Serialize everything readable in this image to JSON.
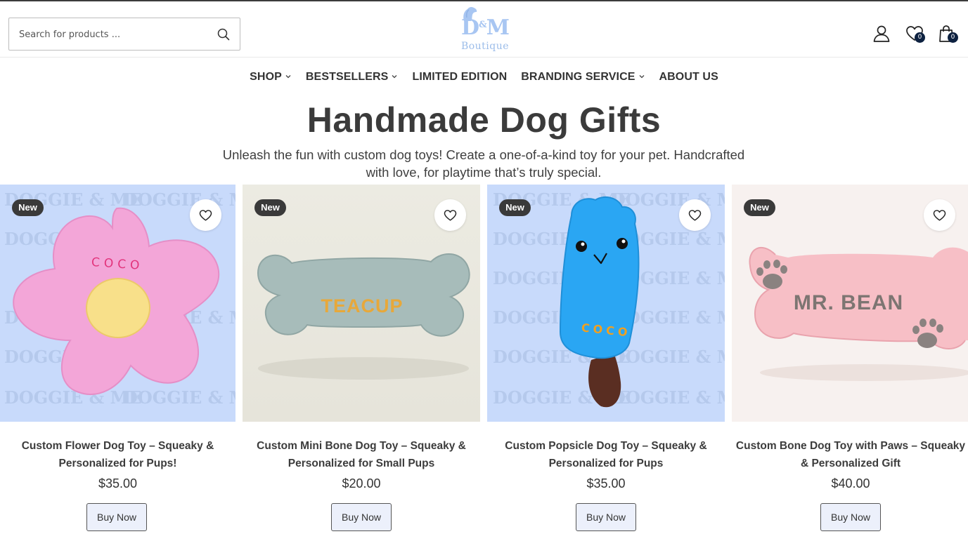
{
  "header": {
    "search": {
      "placeholder": "Search for products ..."
    },
    "logo": {
      "mark": "D&M",
      "sub": "Boutique"
    },
    "wishlist_count": "0",
    "cart_count": "0"
  },
  "nav": {
    "items": [
      {
        "label": "SHOP",
        "has_dropdown": true
      },
      {
        "label": "BESTSELLERS",
        "has_dropdown": true
      },
      {
        "label": "LIMITED EDITION",
        "has_dropdown": false
      },
      {
        "label": "BRANDING SERVICE",
        "has_dropdown": true
      },
      {
        "label": "ABOUT US",
        "has_dropdown": false
      }
    ]
  },
  "hero": {
    "title": "Handmade Dog Gifts",
    "subtitle_line1": "Unleash the fun with custom dog toys! Create a one-of-a-kind toy for your pet. Handcrafted",
    "subtitle_line2": "with love, for playtime that’s truly special."
  },
  "products": [
    {
      "badge": "New",
      "title_line1": "Custom Flower Dog Toy – Squeaky &",
      "title_line2": "Personalized for Pups!",
      "price": "$35.00",
      "button": "Buy Now",
      "toy_text": "COCO",
      "watermark": "DOGGIE & ME"
    },
    {
      "badge": "New",
      "title_line1": "Custom Mini Bone Dog Toy – Squeaky &",
      "title_line2": "Personalized for Small Pups",
      "price": "$20.00",
      "button": "Buy Now",
      "toy_text": "TEACUP"
    },
    {
      "badge": "New",
      "title_line1": "Custom Popsicle Dog Toy – Squeaky &",
      "title_line2": "Personalized for Pups",
      "price": "$35.00",
      "button": "Buy Now",
      "toy_text": "COCO",
      "watermark": "DOGGIE & ME"
    },
    {
      "badge": "New",
      "title_line1": "Custom Bone Dog Toy with Paws – Squeaky",
      "title_line2": "& Personalized Gift",
      "price": "$40.00",
      "button": "Buy Now",
      "toy_text": "MR. BEAN"
    }
  ],
  "colors": {
    "accent_dark": "#0d2140",
    "logo_blue": "#a8c6f2",
    "badge_bg": "#3a3a3a",
    "button_bg": "#ecf0fb",
    "product_bg_blue": "#c8dafb"
  },
  "icons": [
    "search-icon",
    "user-icon",
    "wishlist-icon",
    "cart-icon",
    "heart-icon",
    "chevron-down-icon"
  ]
}
